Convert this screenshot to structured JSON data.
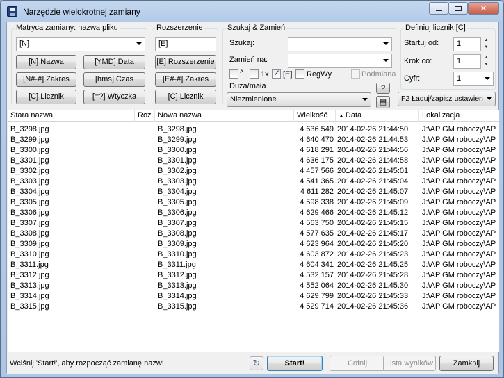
{
  "window": {
    "title": "Narzędzie wielokrotnej zamiany"
  },
  "mask": {
    "title": "Matryca zamiany: nazwa pliku",
    "value": "[N]",
    "buttons": [
      "[N]  Nazwa",
      "[YMD]  Data",
      "[N#-#]  Zakres",
      "[hms]  Czas",
      "[C]  Licznik",
      "[=?]  Wtyczka"
    ]
  },
  "extension": {
    "title": "Rozszerzenie",
    "value": "[E]",
    "buttons": [
      "[E]  Rozszerzenie",
      "[E#-#]  Zakres",
      "[C]  Licznik"
    ]
  },
  "search": {
    "title": "Szukaj & Zamień",
    "find_label": "Szukaj:",
    "find_value": "",
    "replace_label": "Zamień na:",
    "replace_value": "",
    "opt_caret": "^",
    "opt_1x": "1x",
    "opt_e": "[E]",
    "opt_regex": "RegWy",
    "opt_subst": "Podmiana",
    "case_label": "Duża/mała",
    "case_value": "Niezmienione",
    "help": "?"
  },
  "counter": {
    "title": "Definiuj licznik [C]",
    "start_label": "Startuj od:",
    "start_value": "1",
    "step_label": "Krok co:",
    "step_value": "1",
    "digits_label": "Cyfr:",
    "digits_value": "1",
    "f2": "F2 Ładuj/zapisz ustawien"
  },
  "columns": {
    "old": "Stara nazwa",
    "ext": "Roz.",
    "new": "Nowa nazwa",
    "size": "Wielkość",
    "date": "Data",
    "sort_glyph": "▲",
    "loc": "Lokalizacja"
  },
  "files": [
    {
      "old": "B_3298.jpg",
      "new": "B_3298.jpg",
      "size": "4 636 549",
      "date": "2014-02-26 21:44:50",
      "loc": "J:\\AP GM roboczy\\AP"
    },
    {
      "old": "B_3299.jpg",
      "new": "B_3299.jpg",
      "size": "4 640 470",
      "date": "2014-02-26 21:44:53",
      "loc": "J:\\AP GM roboczy\\AP"
    },
    {
      "old": "B_3300.jpg",
      "new": "B_3300.jpg",
      "size": "4 618 291",
      "date": "2014-02-26 21:44:56",
      "loc": "J:\\AP GM roboczy\\AP"
    },
    {
      "old": "B_3301.jpg",
      "new": "B_3301.jpg",
      "size": "4 636 175",
      "date": "2014-02-26 21:44:58",
      "loc": "J:\\AP GM roboczy\\AP"
    },
    {
      "old": "B_3302.jpg",
      "new": "B_3302.jpg",
      "size": "4 457 566",
      "date": "2014-02-26 21:45:01",
      "loc": "J:\\AP GM roboczy\\AP"
    },
    {
      "old": "B_3303.jpg",
      "new": "B_3303.jpg",
      "size": "4 541 365",
      "date": "2014-02-26 21:45:04",
      "loc": "J:\\AP GM roboczy\\AP"
    },
    {
      "old": "B_3304.jpg",
      "new": "B_3304.jpg",
      "size": "4 611 282",
      "date": "2014-02-26 21:45:07",
      "loc": "J:\\AP GM roboczy\\AP"
    },
    {
      "old": "B_3305.jpg",
      "new": "B_3305.jpg",
      "size": "4 598 338",
      "date": "2014-02-26 21:45:09",
      "loc": "J:\\AP GM roboczy\\AP"
    },
    {
      "old": "B_3306.jpg",
      "new": "B_3306.jpg",
      "size": "4 629 466",
      "date": "2014-02-26 21:45:12",
      "loc": "J:\\AP GM roboczy\\AP"
    },
    {
      "old": "B_3307.jpg",
      "new": "B_3307.jpg",
      "size": "4 563 750",
      "date": "2014-02-26 21:45:15",
      "loc": "J:\\AP GM roboczy\\AP"
    },
    {
      "old": "B_3308.jpg",
      "new": "B_3308.jpg",
      "size": "4 577 635",
      "date": "2014-02-26 21:45:17",
      "loc": "J:\\AP GM roboczy\\AP"
    },
    {
      "old": "B_3309.jpg",
      "new": "B_3309.jpg",
      "size": "4 623 964",
      "date": "2014-02-26 21:45:20",
      "loc": "J:\\AP GM roboczy\\AP"
    },
    {
      "old": "B_3310.jpg",
      "new": "B_3310.jpg",
      "size": "4 603 872",
      "date": "2014-02-26 21:45:23",
      "loc": "J:\\AP GM roboczy\\AP"
    },
    {
      "old": "B_3311.jpg",
      "new": "B_3311.jpg",
      "size": "4 604 341",
      "date": "2014-02-26 21:45:25",
      "loc": "J:\\AP GM roboczy\\AP"
    },
    {
      "old": "B_3312.jpg",
      "new": "B_3312.jpg",
      "size": "4 532 157",
      "date": "2014-02-26 21:45:28",
      "loc": "J:\\AP GM roboczy\\AP"
    },
    {
      "old": "B_3313.jpg",
      "new": "B_3313.jpg",
      "size": "4 552 064",
      "date": "2014-02-26 21:45:30",
      "loc": "J:\\AP GM roboczy\\AP"
    },
    {
      "old": "B_3314.jpg",
      "new": "B_3314.jpg",
      "size": "4 629 799",
      "date": "2014-02-26 21:45:33",
      "loc": "J:\\AP GM roboczy\\AP"
    },
    {
      "old": "B_3315.jpg",
      "new": "B_3315.jpg",
      "size": "4 529 714",
      "date": "2014-02-26 21:45:36",
      "loc": "J:\\AP GM roboczy\\AP"
    }
  ],
  "footer": {
    "status": "Wciśnij 'Start!', aby rozpocząć zamianę nazw!",
    "start": "Start!",
    "undo": "Cofnij",
    "results": "Lista wyników",
    "close": "Zamknij"
  },
  "icons": {
    "app": "floppy-disk-icon",
    "undo": "undo-arrow-icon",
    "edit": "edit-list-icon"
  }
}
